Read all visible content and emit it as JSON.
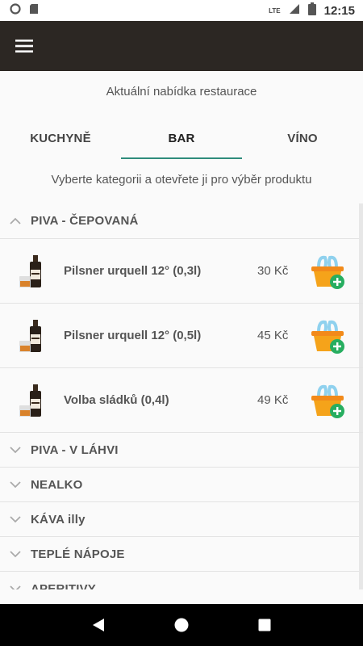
{
  "status_bar": {
    "network": "LTE",
    "time": "12:15"
  },
  "app_bar": {
    "menu_icon": "hamburger-menu-icon"
  },
  "header": {
    "subtitle": "Aktuální nabídka restaurace",
    "hint": "Vyberte kategorii a otevřete ji pro výběr produktu"
  },
  "tabs": [
    {
      "label": "KUCHYNĚ",
      "active": false
    },
    {
      "label": "BAR",
      "active": true
    },
    {
      "label": "VÍNO",
      "active": false
    }
  ],
  "categories": [
    {
      "label": "PIVA - ČEPOVANÁ",
      "expanded": true,
      "products": [
        {
          "name": "Pilsner urquell 12° (0,3l)",
          "price": "30 Kč"
        },
        {
          "name": "Pilsner urquell 12° (0,5l)",
          "price": "45 Kč"
        },
        {
          "name": "Volba sládků (0,4l)",
          "price": "49 Kč"
        }
      ]
    },
    {
      "label": "PIVA - V LÁHVI",
      "expanded": false
    },
    {
      "label": "NEALKO",
      "expanded": false
    },
    {
      "label": "KÁVA illy",
      "expanded": false
    },
    {
      "label": "TEPLÉ NÁPOJE",
      "expanded": false
    },
    {
      "label": "APERITIVY",
      "expanded": false
    }
  ],
  "colors": {
    "app_bar": "#2c2723",
    "tab_indicator": "#2f8c7c",
    "basket_orange": "#f5a31a",
    "basket_add_green": "#27ae60"
  }
}
